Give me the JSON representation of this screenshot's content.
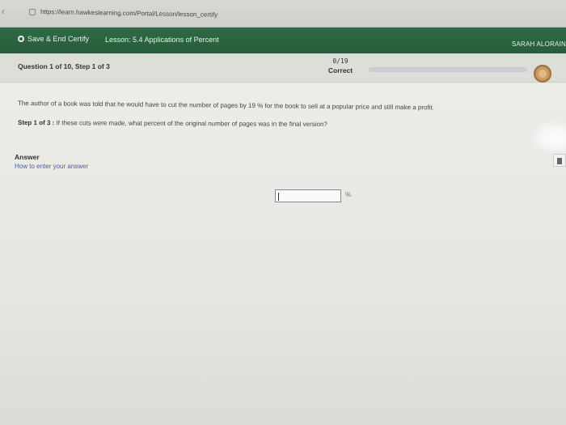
{
  "browser": {
    "url": "https://learn.hawkeslearning.com/Portal/Lesson/lesson_certify"
  },
  "header": {
    "save_label": "Save & End Certify",
    "lesson_label": "Lesson: 5.4 Applications of Percent",
    "user_name": "SARAH ALORAIN"
  },
  "question_bar": {
    "title": "Question 1 of 10, Step 1 of 3",
    "score": "0/19",
    "score_label": "Correct",
    "progress_fraction": 0.0
  },
  "content": {
    "problem_text": "The author of a book was told that he would have to cut the number of pages by 19 % for the book to sell at a popular price and still make a profit.",
    "step_prefix": "Step 1 of 3 :",
    "step_text": "If these cuts were made, what percent of the original number of pages was in the final version?",
    "answer_label": "Answer",
    "howto_link": "How to enter your answer",
    "answer_value": "",
    "unit": "%"
  },
  "colors": {
    "header_green": "#2e6a44",
    "link_blue": "#4a5ea8"
  }
}
